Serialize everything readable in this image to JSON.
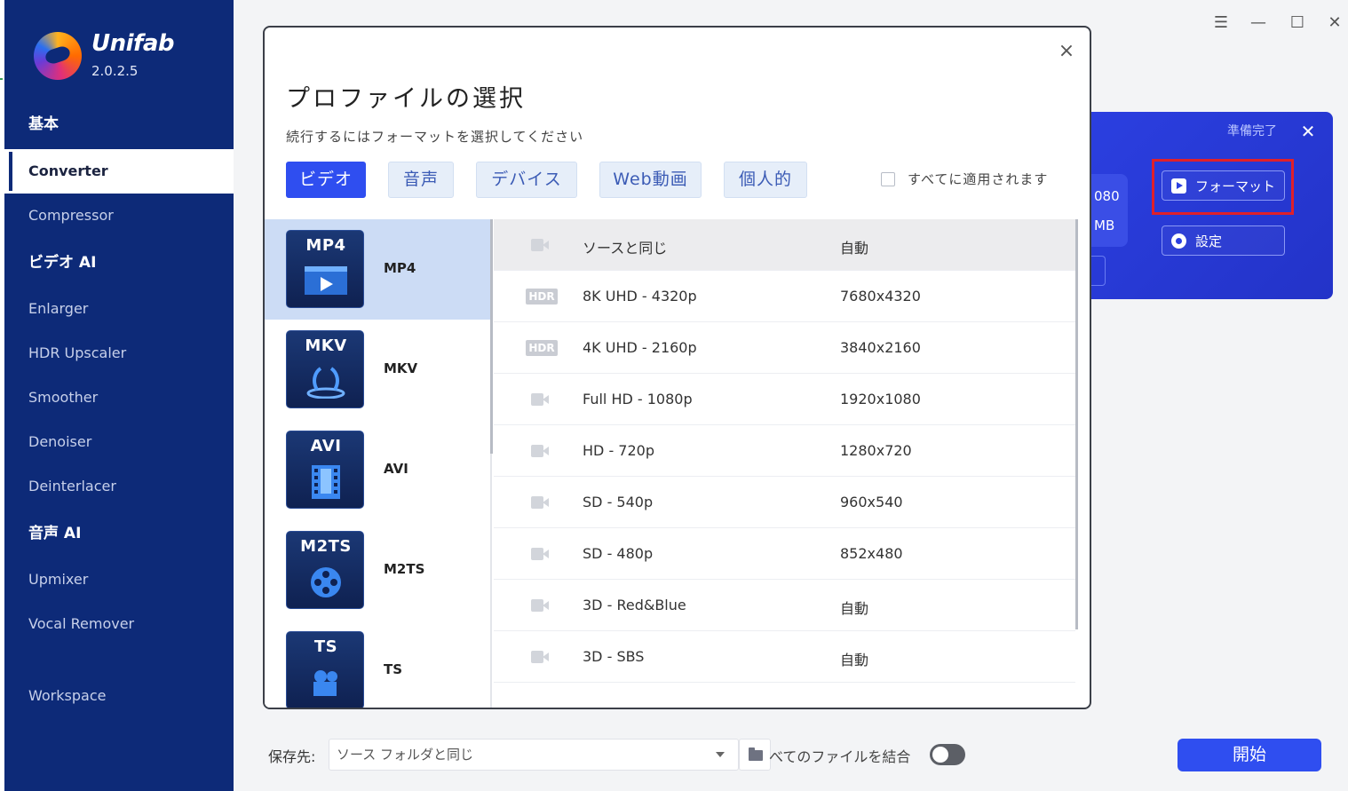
{
  "app": {
    "name": "Unifab",
    "version": "2.0.2.5"
  },
  "sidebar": {
    "items": [
      {
        "label": "基本",
        "type": "header"
      },
      {
        "label": "Converter",
        "type": "active"
      },
      {
        "label": "Compressor",
        "type": "item"
      },
      {
        "label": "ビデオ AI",
        "type": "header"
      },
      {
        "label": "Enlarger",
        "type": "item"
      },
      {
        "label": "HDR Upscaler",
        "type": "item"
      },
      {
        "label": "Smoother",
        "type": "item"
      },
      {
        "label": "Denoiser",
        "type": "item"
      },
      {
        "label": "Deinterlacer",
        "type": "item"
      },
      {
        "label": "音声 AI",
        "type": "header"
      },
      {
        "label": "Upmixer",
        "type": "item"
      },
      {
        "label": "Vocal Remover",
        "type": "item"
      },
      {
        "label": "Workspace",
        "type": "item"
      }
    ]
  },
  "window_controls": {
    "menu": "☰",
    "minimize": "—",
    "maximize": "☐",
    "close": "✕"
  },
  "task": {
    "status": "準備完了",
    "close": "✕",
    "resolution_fragment": "080",
    "size_fragment": "MB",
    "format_button": "フォーマット",
    "settings_button": "設定"
  },
  "modal": {
    "close": "×",
    "title": "プロファイルの選択",
    "subtitle": "続行するにはフォーマットを選択してください",
    "tabs": [
      {
        "label": "ビデオ",
        "active": true
      },
      {
        "label": "音声",
        "active": false
      },
      {
        "label": "デバイス",
        "active": false
      },
      {
        "label": "Web動画",
        "active": false
      },
      {
        "label": "個人的",
        "active": false
      }
    ],
    "apply_all": "すべてに適用されます",
    "formats": [
      {
        "icon_text": "MP4",
        "label": "MP4",
        "selected": true
      },
      {
        "icon_text": "MKV",
        "label": "MKV",
        "selected": false
      },
      {
        "icon_text": "AVI",
        "label": "AVI",
        "selected": false
      },
      {
        "icon_text": "M2TS",
        "label": "M2TS",
        "selected": false
      },
      {
        "icon_text": "TS",
        "label": "TS",
        "selected": false
      }
    ],
    "hdr_badge": "HDR",
    "resolutions": [
      {
        "name": "ソースと同じ",
        "value": "自動",
        "icon": "camera-icon",
        "selected": true
      },
      {
        "name": "8K UHD - 4320p",
        "value": "7680x4320",
        "icon": "hdr-icon",
        "selected": false
      },
      {
        "name": "4K UHD - 2160p",
        "value": "3840x2160",
        "icon": "hdr-icon",
        "selected": false
      },
      {
        "name": "Full HD - 1080p",
        "value": "1920x1080",
        "icon": "camera-icon",
        "selected": false
      },
      {
        "name": "HD - 720p",
        "value": "1280x720",
        "icon": "camera-icon",
        "selected": false
      },
      {
        "name": "SD - 540p",
        "value": "960x540",
        "icon": "camera-icon",
        "selected": false
      },
      {
        "name": "SD - 480p",
        "value": "852x480",
        "icon": "camera-icon",
        "selected": false
      },
      {
        "name": "3D - Red&Blue",
        "value": "自動",
        "icon": "camera-icon",
        "selected": false
      },
      {
        "name": "3D - SBS",
        "value": "自動",
        "icon": "camera-icon",
        "selected": false
      }
    ]
  },
  "bottom": {
    "save_label": "保存先:",
    "save_value": "ソース フォルダと同じ",
    "merge_label": "べてのファイルを結合",
    "start_button": "開始"
  }
}
